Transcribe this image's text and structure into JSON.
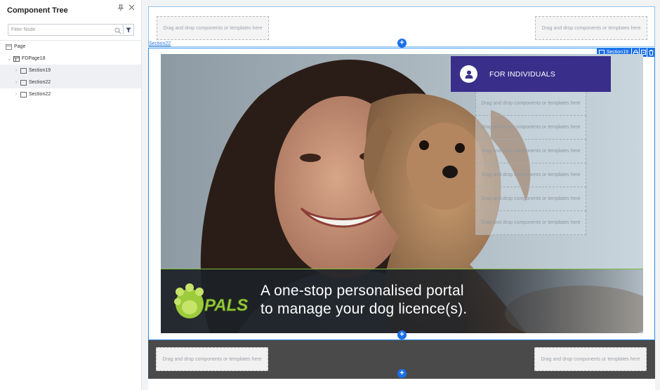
{
  "panel": {
    "title": "Component Tree",
    "filter_placeholder": "Filter Node",
    "tree": [
      {
        "label": "Page"
      },
      {
        "label": "FDPage18"
      },
      {
        "label": "Section19"
      },
      {
        "label": "Section22"
      },
      {
        "label": "Section22"
      }
    ]
  },
  "canvas": {
    "dropzone_text": "Drag and drop components or templates here",
    "section_label": "Section22",
    "selected_badge": "Section19",
    "hero": {
      "cta_label": "FOR INDIVIDUALS",
      "logo_text": "PALS",
      "tagline_line1": "A one-stop personalised portal",
      "tagline_line2": "to manage your dog licence(s)."
    },
    "accent_color": "#1b6fe8",
    "cta_color": "#392f8b"
  }
}
